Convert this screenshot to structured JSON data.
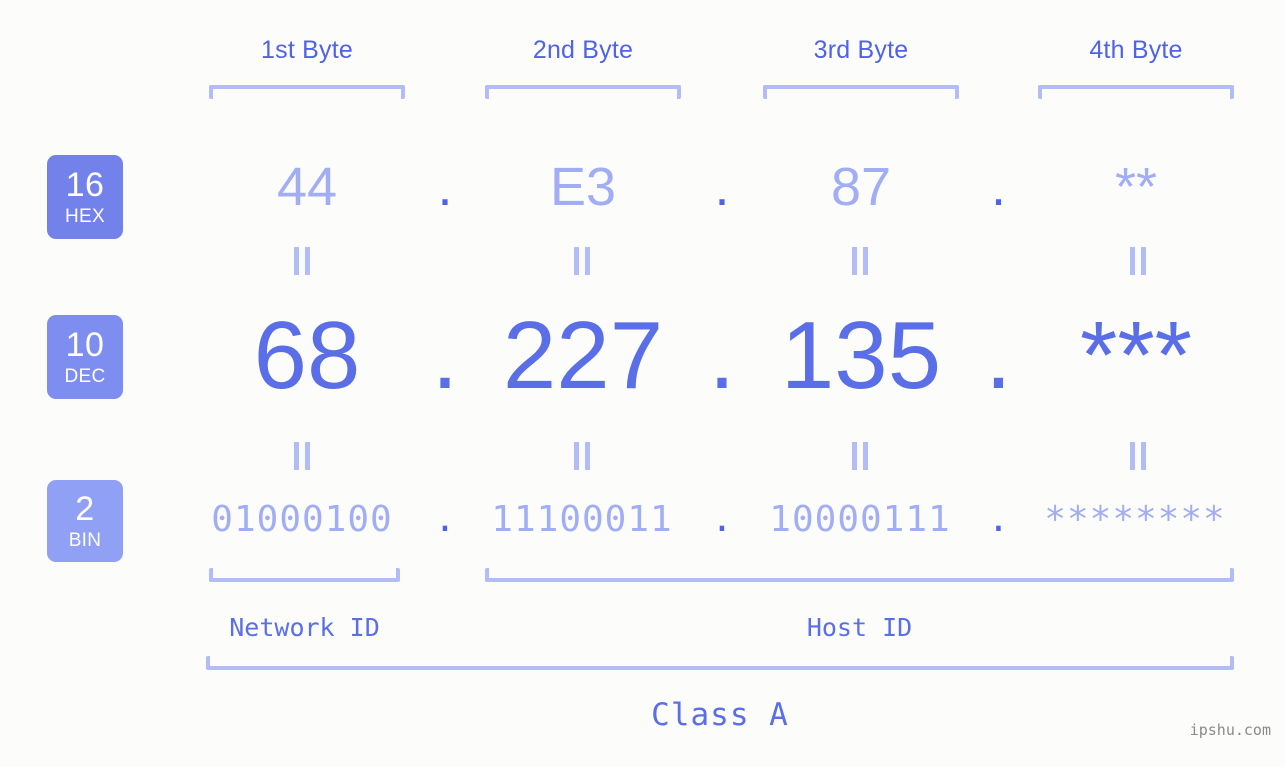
{
  "meta": {
    "background_color": "#fcfdfa",
    "accent_color": "#5a6ee8",
    "accent_light_color": "#a1adf4",
    "bracket_color": "#b2bcf7",
    "badge_color": "#7282ea",
    "badge_color_light": "#90a0f5",
    "watermark": "ipshu.com"
  },
  "byte_headers": [
    {
      "label": "1st Byte"
    },
    {
      "label": "2nd Byte"
    },
    {
      "label": "3rd Byte"
    },
    {
      "label": "4th Byte"
    }
  ],
  "bases": [
    {
      "num": "16",
      "label": "HEX"
    },
    {
      "num": "10",
      "label": "DEC"
    },
    {
      "num": "2",
      "label": "BIN"
    }
  ],
  "rows": {
    "hex": {
      "values": [
        "44",
        "E3",
        "87",
        "**"
      ],
      "separator": "."
    },
    "dec": {
      "values": [
        "68",
        "227",
        "135",
        "***"
      ],
      "separator": "."
    },
    "bin": {
      "values": [
        "01000100",
        "11100011",
        "10000111",
        "********"
      ],
      "separator": "."
    }
  },
  "equality_marker": "||",
  "segments": {
    "network_id": "Network ID",
    "host_id": "Host ID",
    "class": "Class A"
  }
}
